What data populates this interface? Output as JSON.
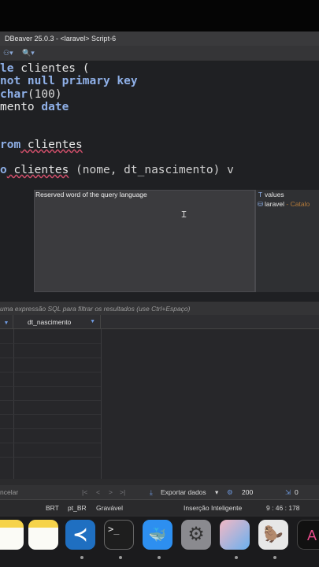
{
  "window": {
    "title": "DBeaver 25.0.3 - <laravel> Script-6"
  },
  "editor": {
    "lines": [
      {
        "a": "le",
        "b": " clientes ("
      },
      {
        "a": "not null primary key"
      },
      {
        "a": "char",
        "b": "(100)"
      },
      {
        "a": "mento",
        "b": " date"
      },
      {
        "a": "rom",
        "b": " clientes"
      },
      {
        "a": "o",
        "b": " clientes",
        "c": " (nome, dt_nascimento) v"
      }
    ]
  },
  "autocomplete": {
    "description": "Reserved word of the query language",
    "items": [
      {
        "label": "values"
      },
      {
        "label": "laravel",
        "suffix": " - Catalo"
      }
    ]
  },
  "filter": {
    "placeholder": "uma expressão SQL para filtrar os resultados (use Ctrl+Espaço)"
  },
  "results": {
    "columns": [
      "dt_nascimento"
    ],
    "cancel_label": "ncelar",
    "export_label": "Exportar dados",
    "row_limit": "200",
    "count": "0"
  },
  "status": {
    "timezone": "BRT",
    "locale": "pt_BR",
    "mode": "Gravável",
    "insert": "Inserção Inteligente",
    "cursor": "9 : 46 : 178"
  },
  "dock": {
    "apps": [
      "notes-icon",
      "vscode-icon",
      "terminal-icon",
      "docker-icon",
      "system-settings-icon",
      "simulator-icon",
      "dbeaver-icon",
      "app-icon"
    ]
  }
}
